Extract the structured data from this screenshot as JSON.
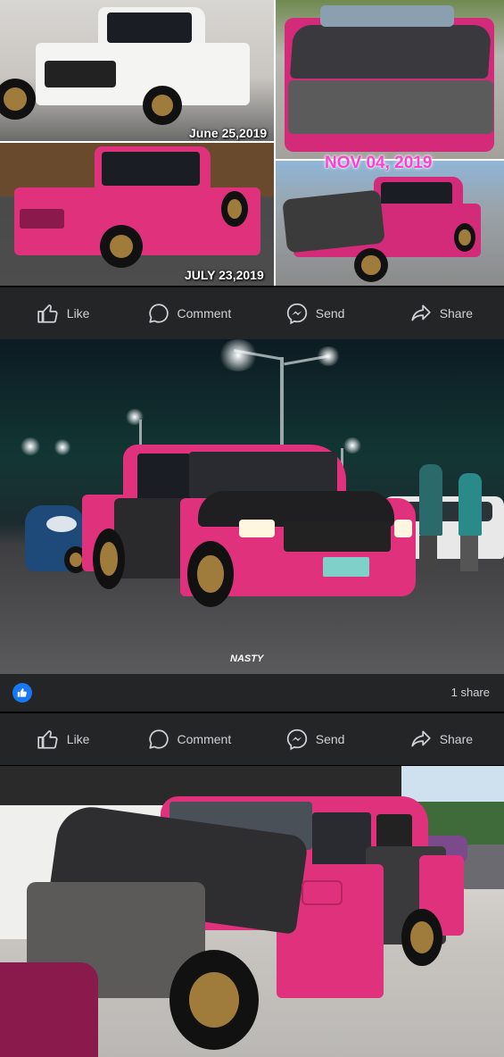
{
  "collage": {
    "dates": {
      "june": "June 25,2019",
      "july": "JULY 23,2019",
      "nov": "NOV 04, 2019"
    }
  },
  "actions": {
    "like": "Like",
    "comment": "Comment",
    "send": "Send",
    "share": "Share"
  },
  "post": {
    "watermark": "NASTY",
    "shares": "1 share"
  },
  "colors": {
    "background": "#18191a",
    "bar": "#242526",
    "accent": "#1877f2",
    "truck_pink": "#e0317d"
  }
}
